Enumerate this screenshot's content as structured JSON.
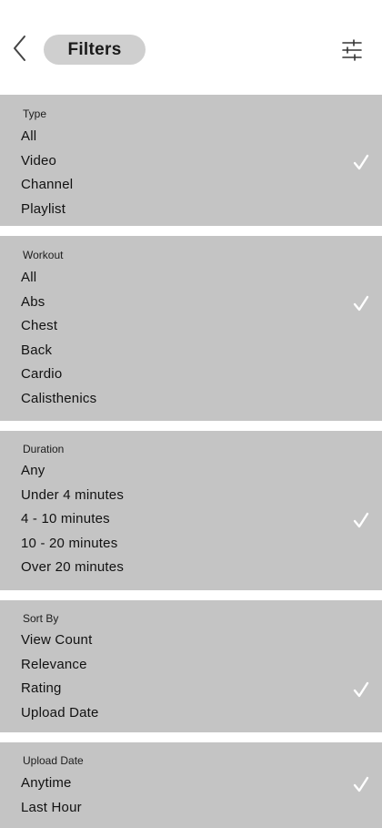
{
  "header": {
    "title": "Filters",
    "back_icon": "chevron-left-icon",
    "settings_icon": "sliders-icon"
  },
  "colors": {
    "section_bg": "#c4c4c4",
    "pill_bg": "#cfcfcf",
    "check": "#ffffff"
  },
  "sections": [
    {
      "title": "Type",
      "options": [
        "All",
        "Video",
        "Channel",
        "Playlist"
      ],
      "selected": "Video"
    },
    {
      "title": "Workout",
      "options": [
        "All",
        "Abs",
        "Chest",
        "Back",
        "Cardio",
        "Calisthenics"
      ],
      "selected": "Abs"
    },
    {
      "title": "Duration",
      "options": [
        "Any",
        "Under 4 minutes",
        "4 - 10 minutes",
        "10 - 20 minutes",
        "Over 20 minutes"
      ],
      "selected": "4 - 10 minutes"
    },
    {
      "title": "Sort By",
      "options": [
        "View Count",
        "Relevance",
        "Rating",
        "Upload Date"
      ],
      "selected": "Rating"
    },
    {
      "title": "Upload Date",
      "options": [
        "Anytime",
        "Last Hour"
      ],
      "selected": "Anytime"
    }
  ]
}
